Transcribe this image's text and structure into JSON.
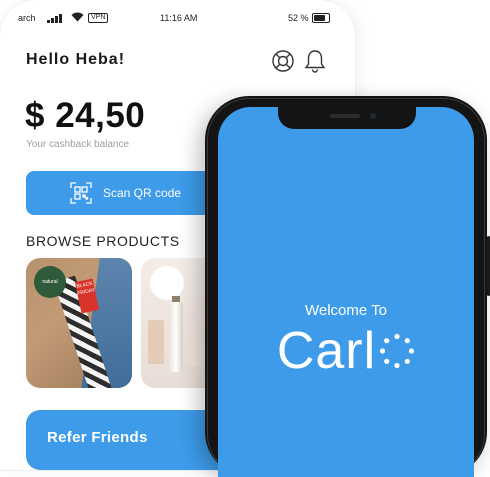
{
  "status_bar": {
    "carrier": "arch",
    "vpn": "VPN",
    "time": "11:16 AM",
    "battery": "52 %"
  },
  "app": {
    "greeting": "Hello Heba!",
    "balance": "$ 24,50",
    "balance_label": "Your cashback balance",
    "scan_label": "Scan QR code",
    "browse_title": "BROWSE PRODUCTS",
    "refer_label": "Refer Friends",
    "products": [
      {
        "logo": "natural",
        "tag": "BLACK FRIDAY"
      },
      {
        "logo": ""
      }
    ]
  },
  "splash": {
    "welcome": "Welcome To",
    "brand": "Carl"
  },
  "colors": {
    "accent": "#3d9be9",
    "text": "#1a1a1a"
  },
  "icons": [
    "signal-icon",
    "wifi-icon",
    "battery-icon",
    "support-icon",
    "bell-icon",
    "qr-icon",
    "carlo-o-icon"
  ]
}
